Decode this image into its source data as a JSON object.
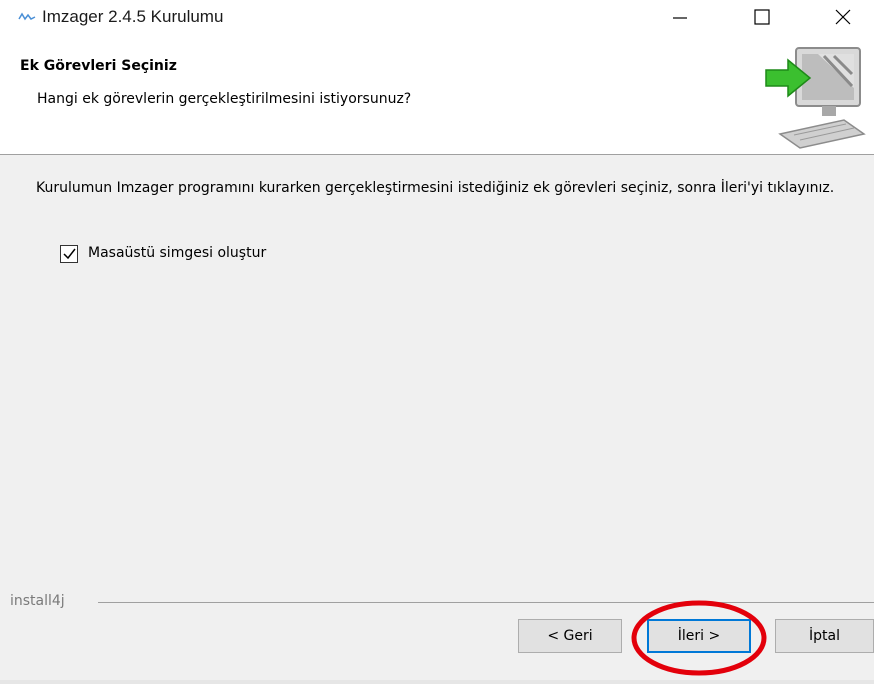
{
  "window": {
    "title": "Imzager 2.4.5 Kurulumu"
  },
  "header": {
    "title": "Ek Görevleri Seçiniz",
    "subtitle": "Hangi ek görevlerin gerçekleştirilmesini istiyorsunuz?"
  },
  "content": {
    "description": "Kurulumun Imzager programını kurarken gerçekleştirmesini istediğiniz ek görevleri seçiniz, sonra İleri'yi tıklayınız.",
    "checkbox": {
      "label": "Masaüstü simgesi oluştur",
      "checked": true
    }
  },
  "footer": {
    "brand": "install4j",
    "buttons": {
      "back": "< Geri",
      "next": "İleri >",
      "cancel": "İptal"
    }
  },
  "colors": {
    "content_bg": "#f0f0f0",
    "highlight": "#e3000b",
    "arrow": "#3bbf2f"
  },
  "icons": [
    "app-icon",
    "minimize-icon",
    "maximize-icon",
    "close-icon",
    "computer-arrow-graphic",
    "check-icon"
  ]
}
